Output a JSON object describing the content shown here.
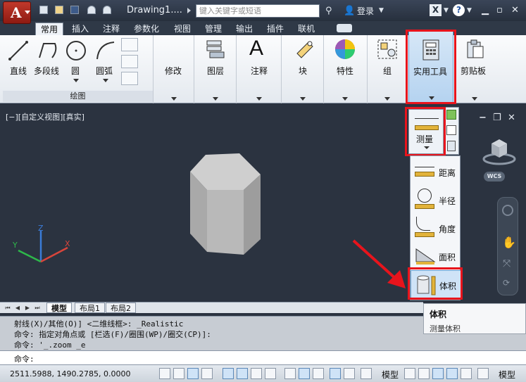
{
  "app": {
    "logo_letter": "A",
    "document_title": "Drawing1....",
    "search_placeholder": "键入关键字或短语",
    "login_label": "登录"
  },
  "tabs": [
    {
      "label": "常用",
      "active": true
    },
    {
      "label": "插入"
    },
    {
      "label": "注释"
    },
    {
      "label": "参数化"
    },
    {
      "label": "视图"
    },
    {
      "label": "管理"
    },
    {
      "label": "输出"
    },
    {
      "label": "插件"
    },
    {
      "label": "联机"
    }
  ],
  "ribbon": {
    "draw": {
      "line": "直线",
      "polyline": "多段线",
      "circle": "圆",
      "arc": "圆弧",
      "panel_title": "绘图"
    },
    "modify": "修改",
    "layers": "图层",
    "annotation": "注释",
    "block": "块",
    "properties": "特性",
    "groups": "组",
    "utilities": "实用工具",
    "clipboard": "剪贴板"
  },
  "viewport": {
    "label": "[−][自定义视图][真实]",
    "wcs": "WCS"
  },
  "measure": {
    "label": "测量",
    "items": [
      {
        "label": "距离"
      },
      {
        "label": "半径"
      },
      {
        "label": "角度"
      },
      {
        "label": "面积"
      },
      {
        "label": "体积",
        "selected": true
      }
    ]
  },
  "tooltip": {
    "title": "体积",
    "desc": "测量体积"
  },
  "layout_tabs": [
    "模型",
    "布局1",
    "布局2"
  ],
  "command": {
    "history": [
      "射线(X)/其他(O)] <二维线框>: _Realistic",
      "命令: 指定对角点或 [栏选(F)/圈围(WP)/圈交(CP)]:",
      "命令: '_.zoom _e"
    ],
    "prompt": "命令:"
  },
  "status": {
    "coords": "2511.5988, 1490.2785, 0.0000",
    "model_label_1": "模型",
    "model_label_2": "模型"
  },
  "colors": {
    "highlight_red": "#e8141c",
    "viewport_bg": "#2b3340",
    "selection_blue": "#cfe3f7"
  }
}
